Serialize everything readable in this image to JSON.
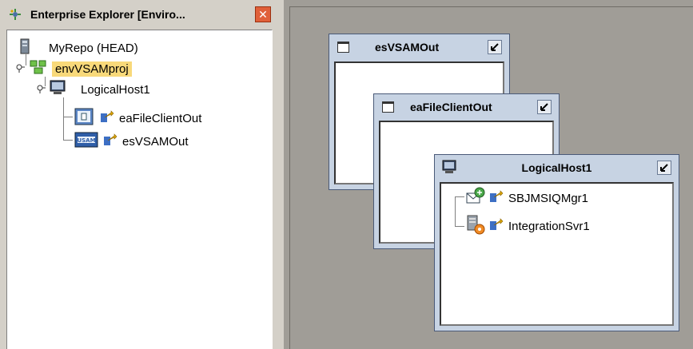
{
  "explorer": {
    "title": "Enterprise Explorer [Enviro...",
    "tree": {
      "repo": "MyRepo (HEAD)",
      "project": "envVSAMproj",
      "host": "LogicalHost1",
      "client_out": "eaFileClientOut",
      "vsam_out": "esVSAMOut"
    }
  },
  "canvas": {
    "frames": {
      "esvsam": {
        "title": "esVSAMOut"
      },
      "eafile": {
        "title": "eaFileClientOut"
      },
      "logical": {
        "title": "LogicalHost1",
        "items": [
          "SBJMSIQMgr1",
          "IntegrationSvr1"
        ]
      }
    }
  },
  "colors": {
    "frame_bg": "#c7d3e3",
    "canvas_bg": "#a09d97",
    "selection": "#f8d97a",
    "close": "#e0603a"
  }
}
